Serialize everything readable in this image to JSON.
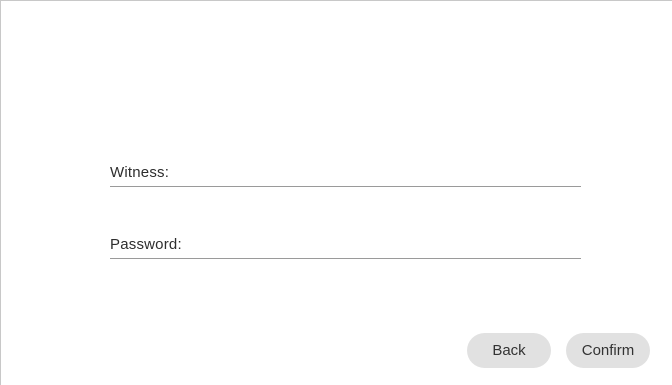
{
  "form": {
    "witness": {
      "label": "Witness:",
      "value": ""
    },
    "password": {
      "label": "Password:",
      "value": ""
    }
  },
  "actions": {
    "back_label": "Back",
    "confirm_label": "Confirm"
  },
  "colors": {
    "background": "#ffffff",
    "button_bg": "#e1e1e1",
    "text": "#2e2e2e",
    "underline": "#9a9a9a"
  }
}
